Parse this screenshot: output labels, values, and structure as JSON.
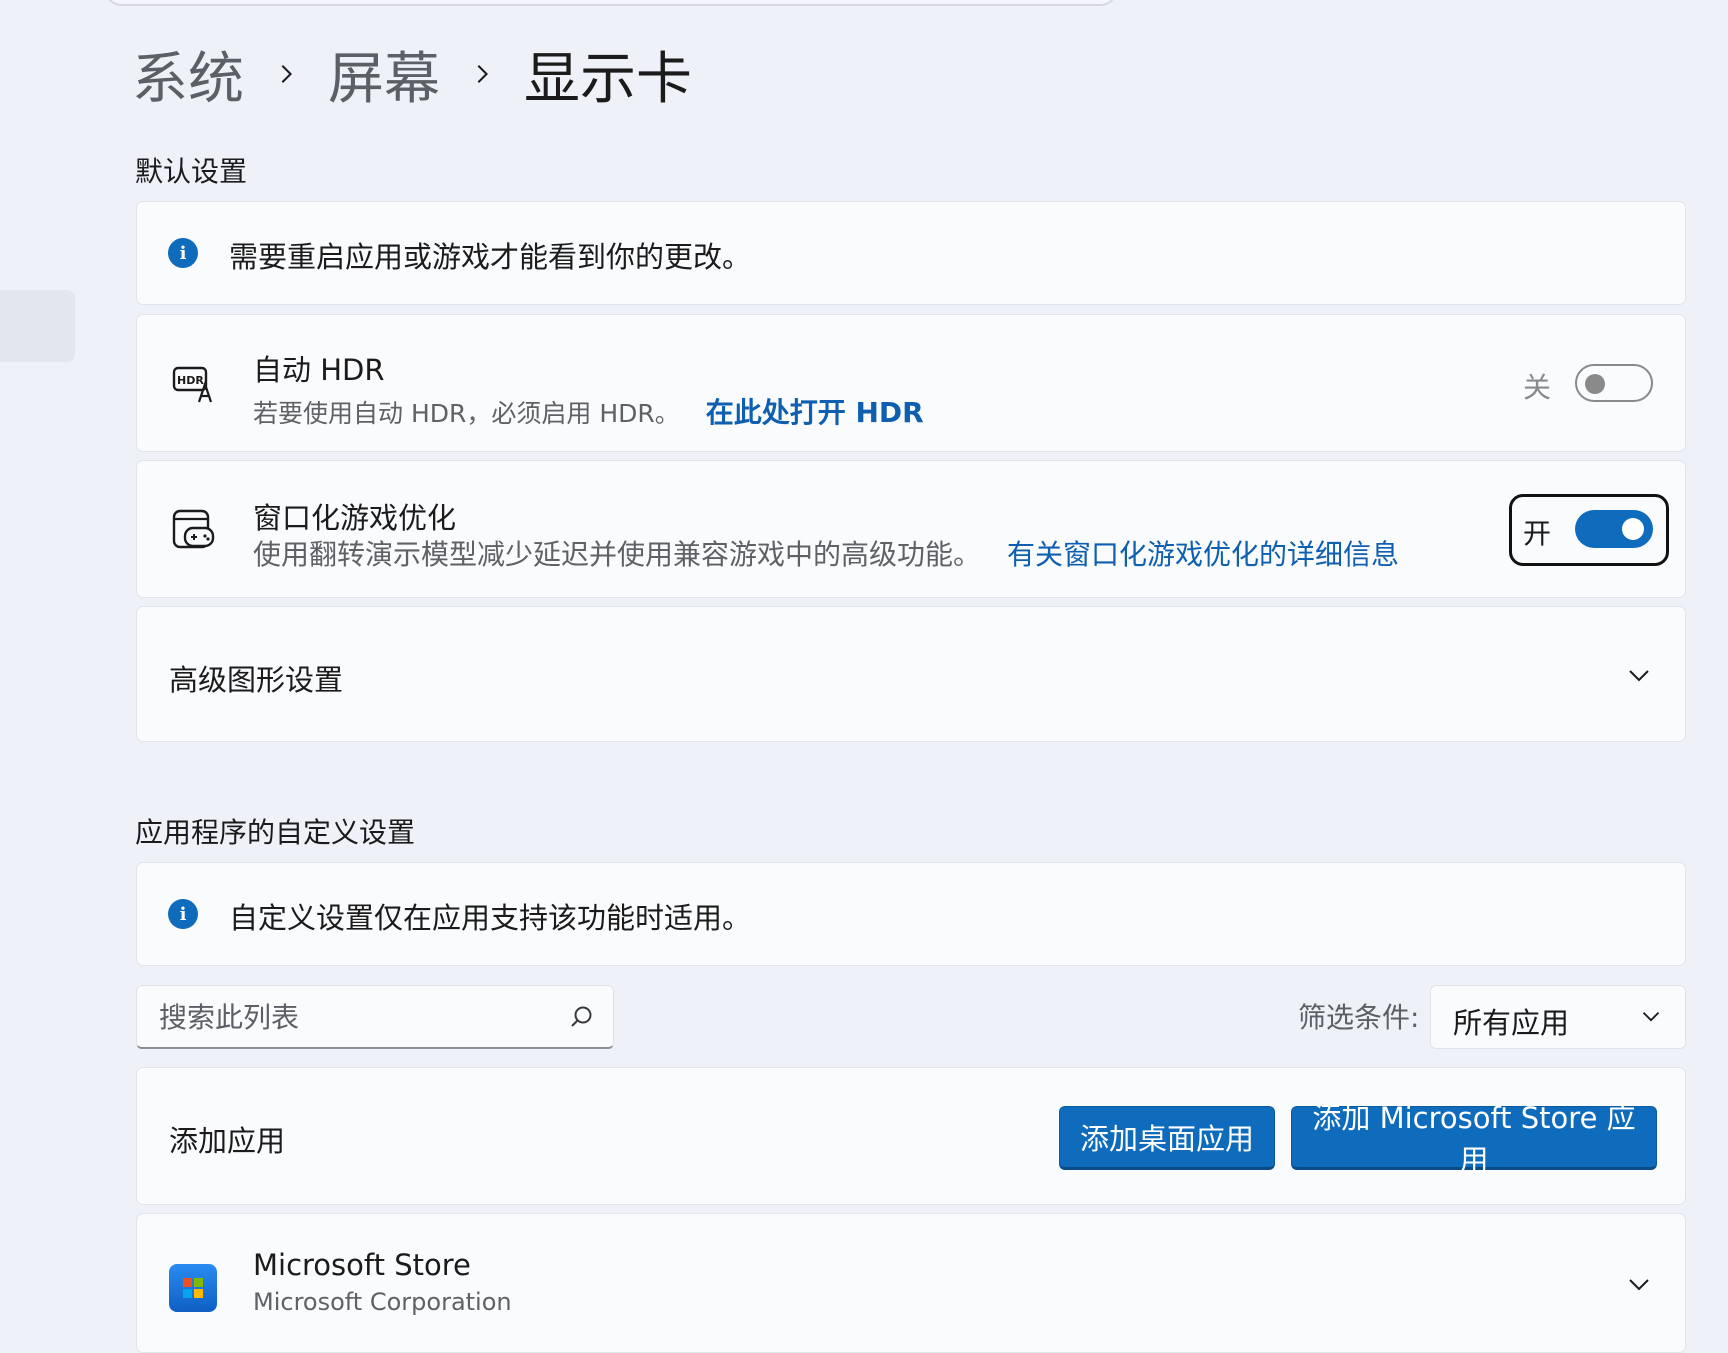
{
  "breadcrumb": {
    "items": [
      "系统",
      "屏幕",
      "显示卡"
    ]
  },
  "default_settings": {
    "title": "默认设置",
    "info": "需要重启应用或游戏才能看到你的更改。",
    "auto_hdr": {
      "title": "自动 HDR",
      "description": "若要使用自动 HDR，必须启用 HDR。",
      "link": "在此处打开 HDR",
      "toggle_state": "关",
      "toggle_on": false
    },
    "windowed_games": {
      "title": "窗口化游戏优化",
      "description": "使用翻转演示模型减少延迟并使用兼容游戏中的高级功能。",
      "link": "有关窗口化游戏优化的详细信息",
      "toggle_state": "开",
      "toggle_on": true
    },
    "advanced_graphics": {
      "title": "高级图形设置"
    }
  },
  "custom_settings": {
    "title": "应用程序的自定义设置",
    "info": "自定义设置仅在应用支持该功能时适用。",
    "search": {
      "placeholder": "搜索此列表",
      "value": ""
    },
    "filter": {
      "label": "筛选条件:",
      "selected": "所有应用"
    },
    "add_apps": {
      "title": "添加应用",
      "desktop_button": "添加桌面应用",
      "store_button": "添加 Microsoft Store 应用"
    },
    "apps": [
      {
        "name": "Microsoft Store",
        "publisher": "Microsoft Corporation"
      }
    ]
  },
  "colors": {
    "accent": "#0f6cbd",
    "link": "#0f5fb0",
    "background": "#eef1f8",
    "card": "#fafbfd"
  }
}
